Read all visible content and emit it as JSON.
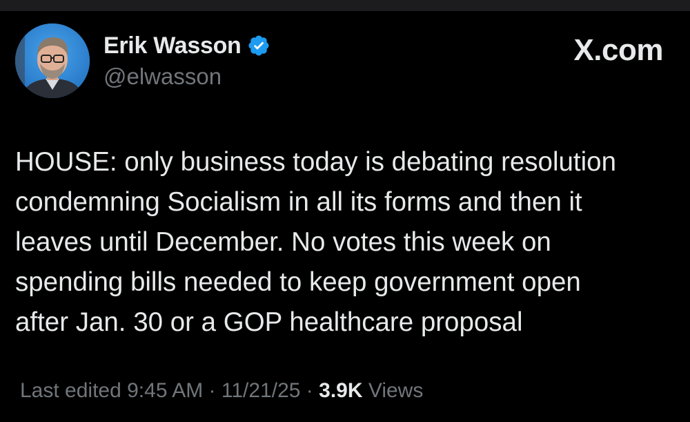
{
  "author": {
    "name": "Erik Wasson",
    "handle": "@elwasson",
    "verified": true,
    "verified_color": "#1d9bf0"
  },
  "brand": "X.com",
  "tweet": {
    "lines": [
      "HOUSE: only business today is debating resolution",
      "condemning Socialism in all its forms and then it",
      "leaves until December. No votes this week on",
      "spending bills needed to keep government open",
      "after Jan. 30 or a GOP healthcare proposal"
    ]
  },
  "meta": {
    "edited_label": "Last edited",
    "time": "9:45 AM",
    "separator": "·",
    "date": "11/21/25",
    "views_count": "3.9K",
    "views_label": "Views"
  },
  "colors": {
    "background": "#000000",
    "text_primary": "#e7e9ea",
    "text_secondary": "#71767b",
    "avatar_background": "#2a7fd0"
  },
  "icons": {
    "verified": "verified-badge-icon",
    "avatar": "profile-photo"
  }
}
